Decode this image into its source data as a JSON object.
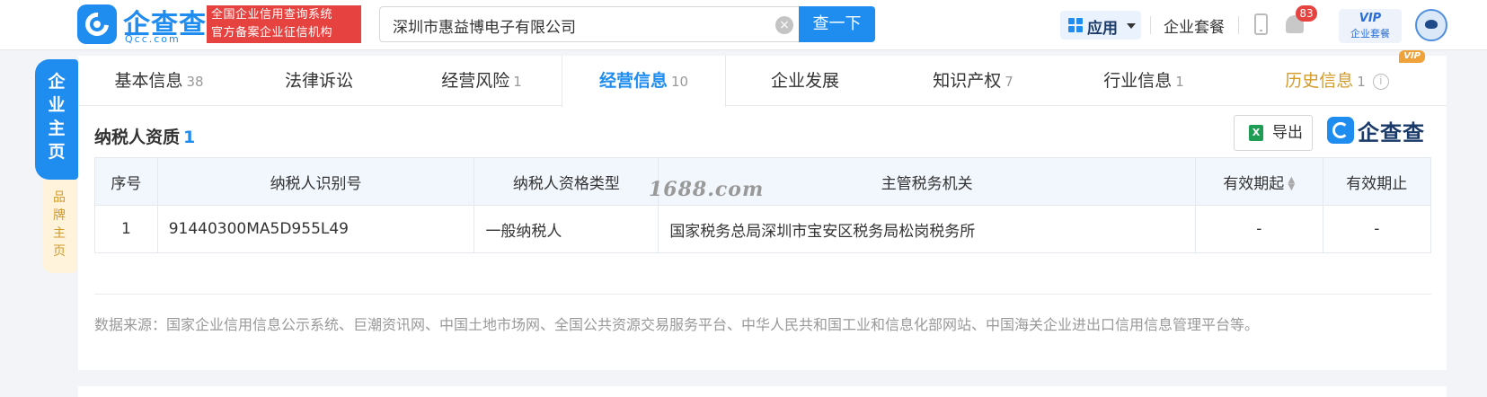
{
  "header": {
    "logo_text": "企查查",
    "logo_sub": "Qcc.com",
    "slogan_line1": "全国企业信用查询系统",
    "slogan_line2": "官方备案企业征信机构",
    "search_value": "深圳市惠益博电子有限公司",
    "search_button": "查一下",
    "app_menu": "应用",
    "package_link": "企业套餐",
    "notification_count": "83",
    "vip_top": "VIP",
    "vip_bottom": "企业套餐"
  },
  "side": {
    "main_tab": "企业主页",
    "brand_tab": "品牌主页"
  },
  "tabs": [
    {
      "label": "基本信息",
      "count": "38"
    },
    {
      "label": "法律诉讼",
      "count": ""
    },
    {
      "label": "经营风险",
      "count": "1"
    },
    {
      "label": "经营信息",
      "count": "10"
    },
    {
      "label": "企业发展",
      "count": ""
    },
    {
      "label": "知识产权",
      "count": "7"
    },
    {
      "label": "行业信息",
      "count": "1"
    },
    {
      "label": "历史信息",
      "count": "1",
      "tag": "VIP"
    }
  ],
  "section": {
    "title": "纳税人资质",
    "count": "1",
    "export_label": "导出",
    "brand_logo": "企查查"
  },
  "table": {
    "headers": [
      "序号",
      "纳税人识别号",
      "纳税人资格类型",
      "主管税务机关",
      "有效期起",
      "有效期止"
    ],
    "rows": [
      [
        "1",
        "91440300MA5D955L49",
        "一般纳税人",
        "国家税务总局深圳市宝安区税务局松岗税务所",
        "-",
        "-"
      ]
    ]
  },
  "watermark": "1688.com",
  "source_note": "数据来源：国家企业信用信息公示系统、巨潮资讯网、中国土地市场网、全国公共资源交易服务平台、中华人民共和国工业和信息化部网站、中国海关企业进出口信用信息管理平台等。",
  "colors": {
    "brand_blue": "#1f8cf0",
    "slogan_red": "#e64340",
    "history_gold": "#d49a2a",
    "table_header_bg": "#f2f7fd"
  },
  "icons": [
    "search-clear-icon",
    "app-grid-icon",
    "caret-down-icon",
    "phone-icon",
    "bell-icon",
    "excel-icon",
    "sort-icon",
    "info-icon"
  ]
}
